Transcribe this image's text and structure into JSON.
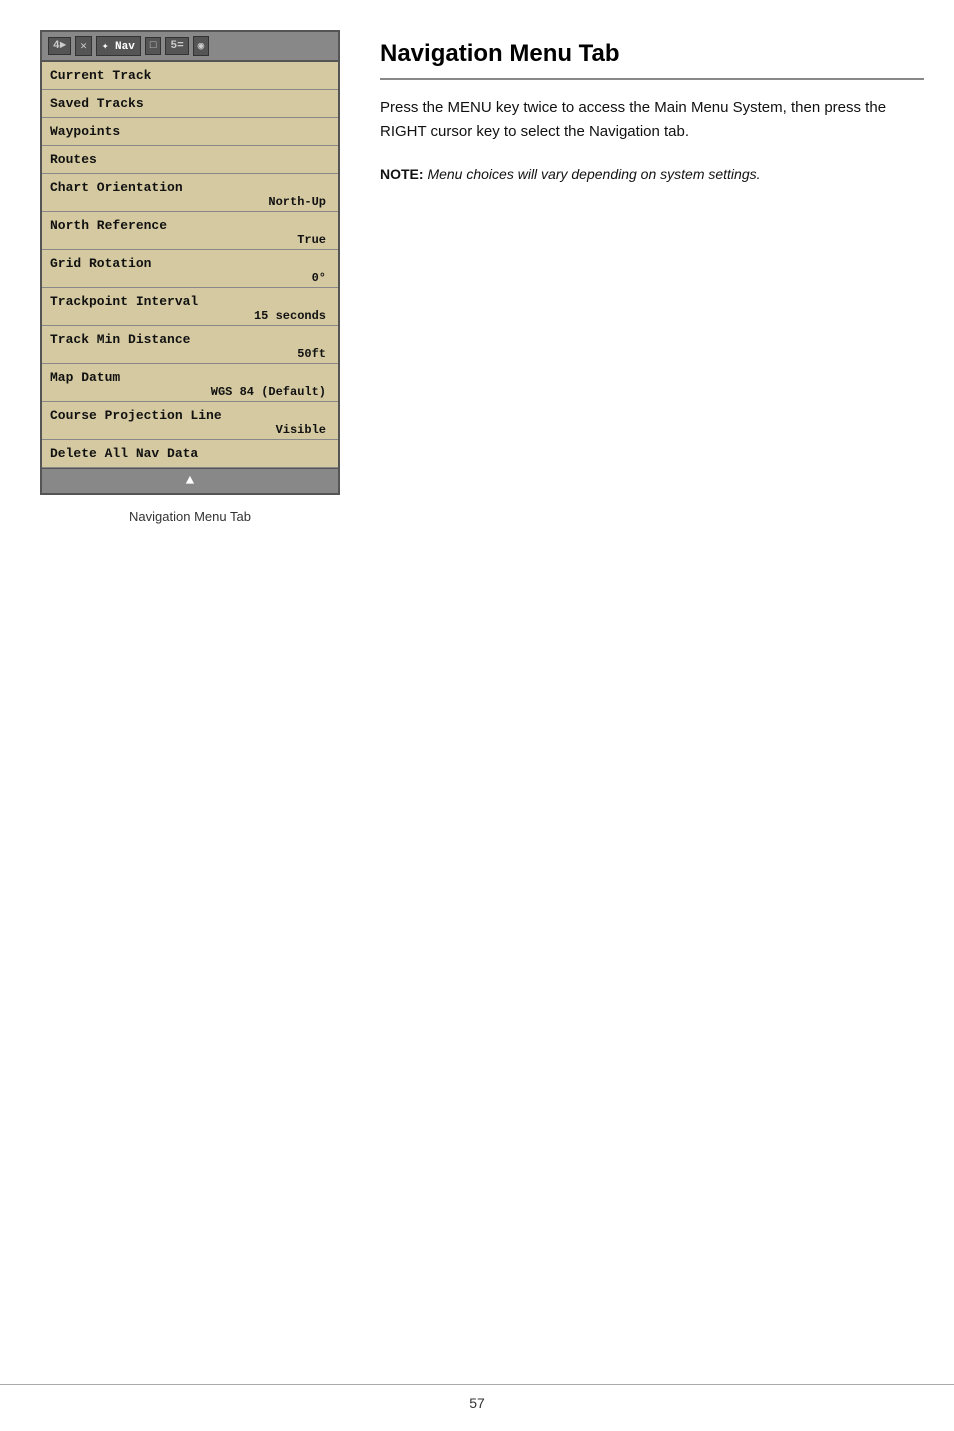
{
  "page": {
    "number": "57"
  },
  "caption": {
    "text": "Navigation Menu Tab"
  },
  "doc": {
    "title": "Navigation Menu Tab",
    "body": "Press the MENU key twice to access the Main Menu System, then press the RIGHT cursor key to select the Navigation tab.",
    "note_label": "NOTE:",
    "note_text": " Menu choices will vary depending on system settings."
  },
  "toolbar": {
    "icon1": "4►",
    "icon2": "✕",
    "nav_label": "✦ Nav",
    "icon3": "□",
    "icon4": "5=",
    "icon5": "◉"
  },
  "menu": {
    "items": [
      {
        "label": "Current Track",
        "value": null
      },
      {
        "label": "Saved Tracks",
        "value": null
      },
      {
        "label": "Waypoints",
        "value": null
      },
      {
        "label": "Routes",
        "value": null
      },
      {
        "label": "Chart Orientation",
        "value": "North-Up"
      },
      {
        "label": "North Reference",
        "value": "True"
      },
      {
        "label": "Grid Rotation",
        "value": "0°"
      },
      {
        "label": "Trackpoint Interval",
        "value": "15 seconds"
      },
      {
        "label": "Track Min Distance",
        "value": "50ft"
      },
      {
        "label": "Map Datum",
        "value": "WGS 84 (Default)"
      },
      {
        "label": "Course Projection Line",
        "value": "Visible"
      },
      {
        "label": "Delete All Nav Data",
        "value": null
      }
    ]
  }
}
